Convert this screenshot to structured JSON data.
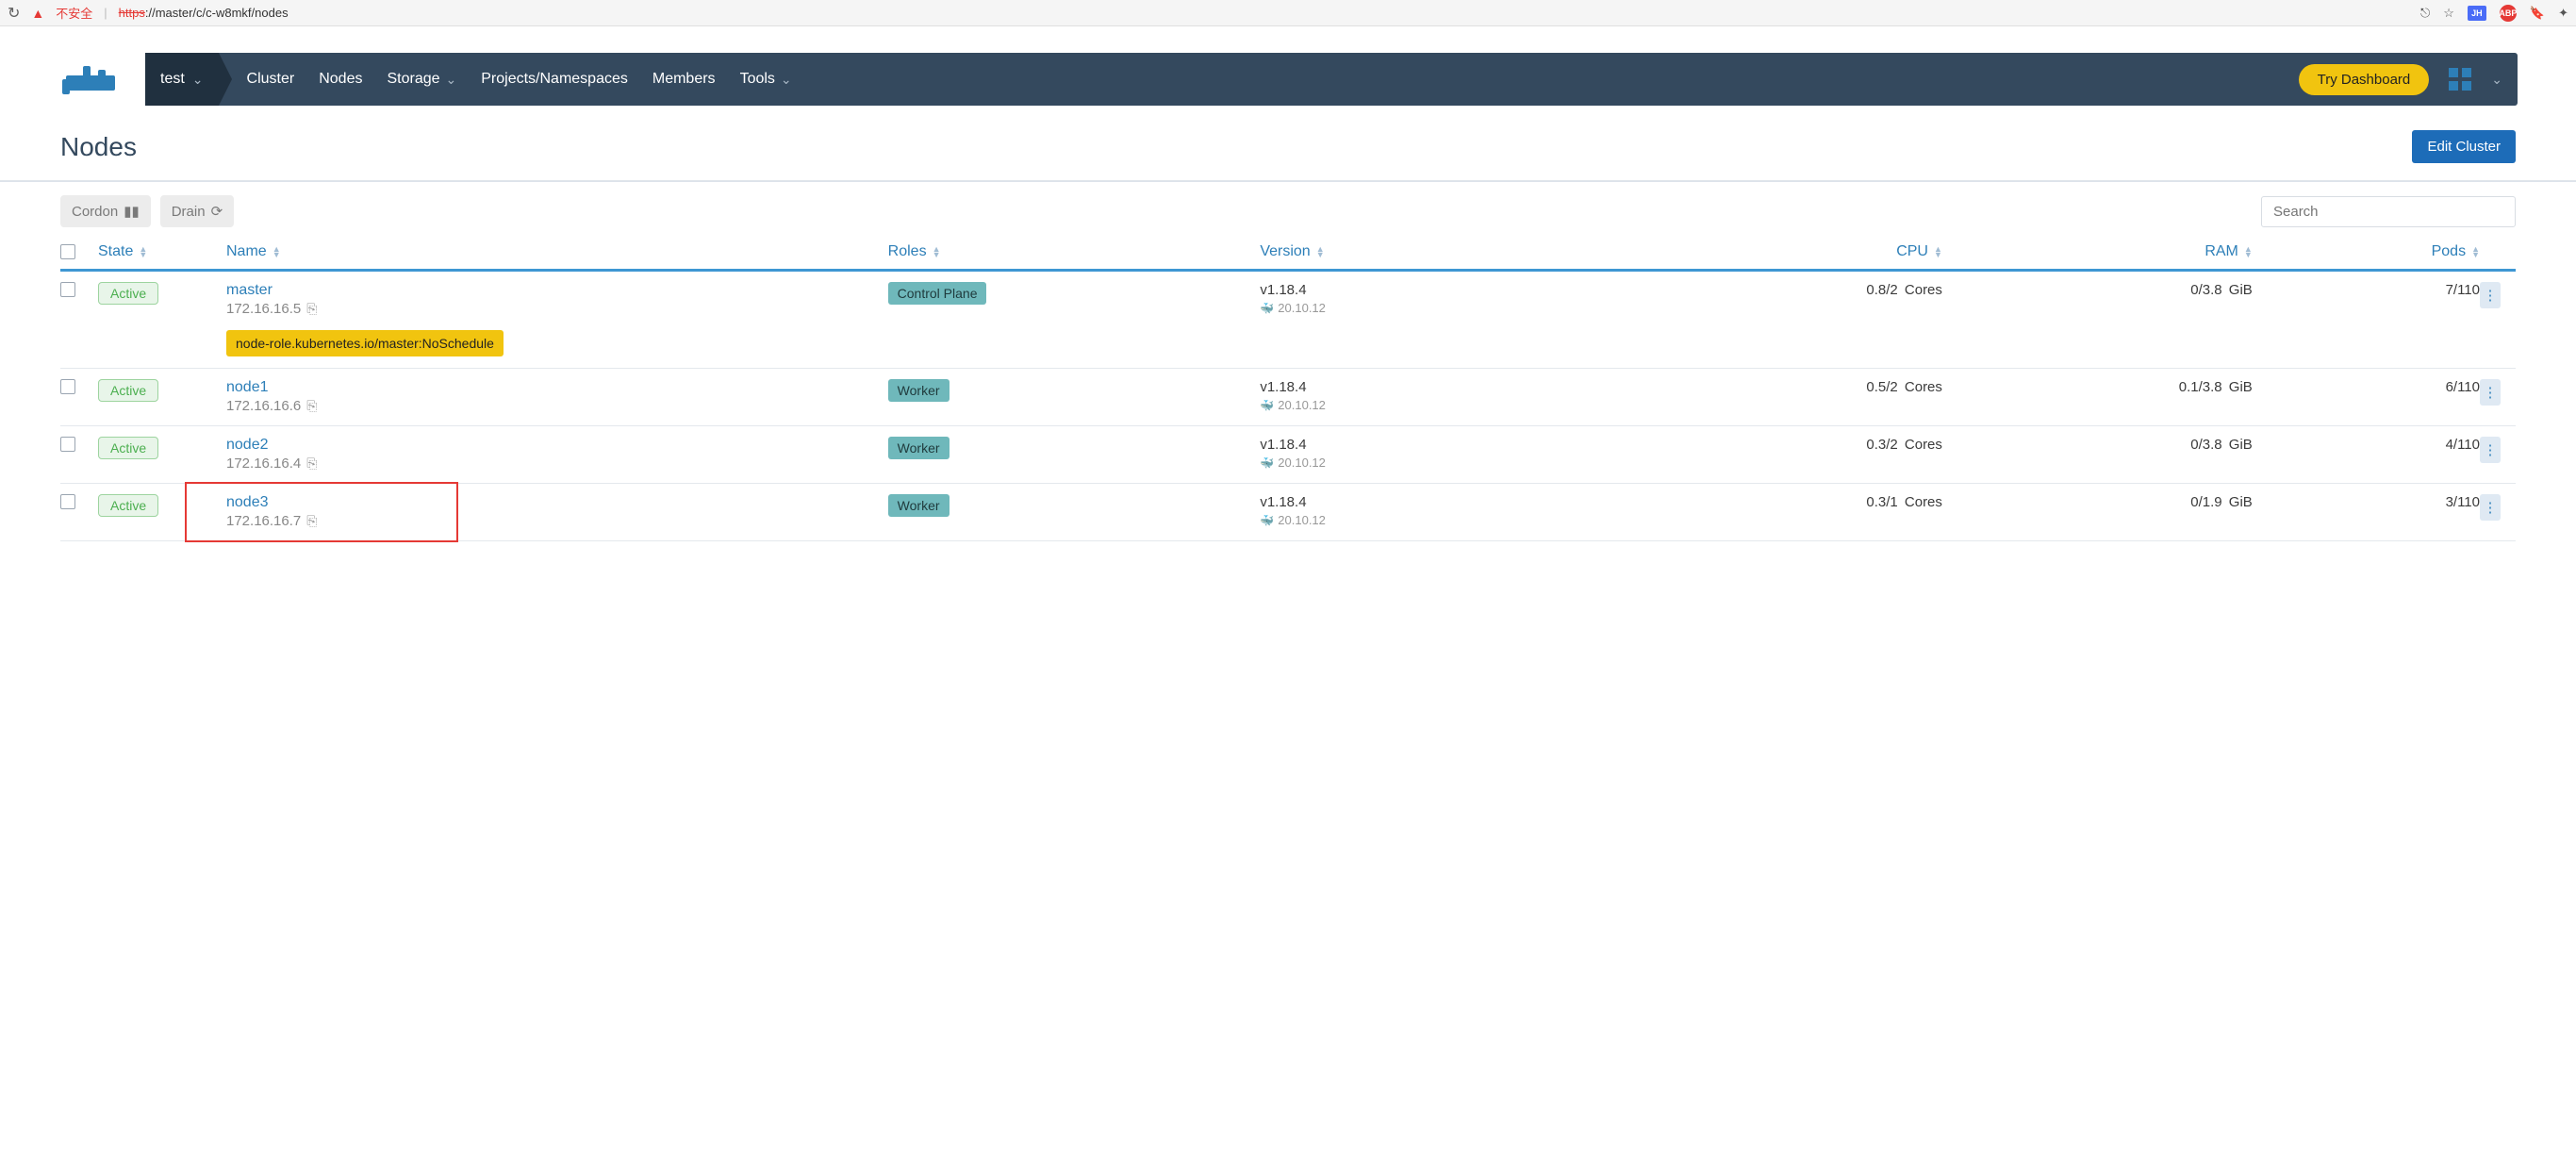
{
  "browser": {
    "insecure_label": "不安全",
    "url_protocol": "https",
    "url_rest": "://master/c/c-w8mkf/nodes"
  },
  "nav": {
    "cluster_selector": "test",
    "items": [
      "Cluster",
      "Nodes",
      "Storage",
      "Projects/Namespaces",
      "Members",
      "Tools"
    ],
    "try_dashboard": "Try Dashboard"
  },
  "page_title": "Nodes",
  "edit_cluster_label": "Edit Cluster",
  "toolbar": {
    "cordon": "Cordon",
    "drain": "Drain",
    "search_placeholder": "Search"
  },
  "columns": {
    "state": "State",
    "name": "Name",
    "roles": "Roles",
    "version": "Version",
    "cpu": "CPU",
    "ram": "RAM",
    "pods": "Pods"
  },
  "roles": {
    "control_plane": "Control Plane",
    "worker": "Worker"
  },
  "nodes": [
    {
      "state": "Active",
      "name": "master",
      "ip": "172.16.16.5",
      "role": "control_plane",
      "version": "v1.18.4",
      "docker": "20.10.12",
      "cpu": "0.8/2 Cores",
      "ram": "0/3.8 GiB",
      "pods": "7/110",
      "taint": "node-role.kubernetes.io/master:NoSchedule"
    },
    {
      "state": "Active",
      "name": "node1",
      "ip": "172.16.16.6",
      "role": "worker",
      "version": "v1.18.4",
      "docker": "20.10.12",
      "cpu": "0.5/2 Cores",
      "ram": "0.1/3.8 GiB",
      "pods": "6/110"
    },
    {
      "state": "Active",
      "name": "node2",
      "ip": "172.16.16.4",
      "role": "worker",
      "version": "v1.18.4",
      "docker": "20.10.12",
      "cpu": "0.3/2 Cores",
      "ram": "0/3.8 GiB",
      "pods": "4/110"
    },
    {
      "state": "Active",
      "name": "node3",
      "ip": "172.16.16.7",
      "role": "worker",
      "version": "v1.18.4",
      "docker": "20.10.12",
      "cpu": "0.3/1 Cores",
      "ram": "0/1.9 GiB",
      "pods": "3/110",
      "highlighted": true
    }
  ]
}
